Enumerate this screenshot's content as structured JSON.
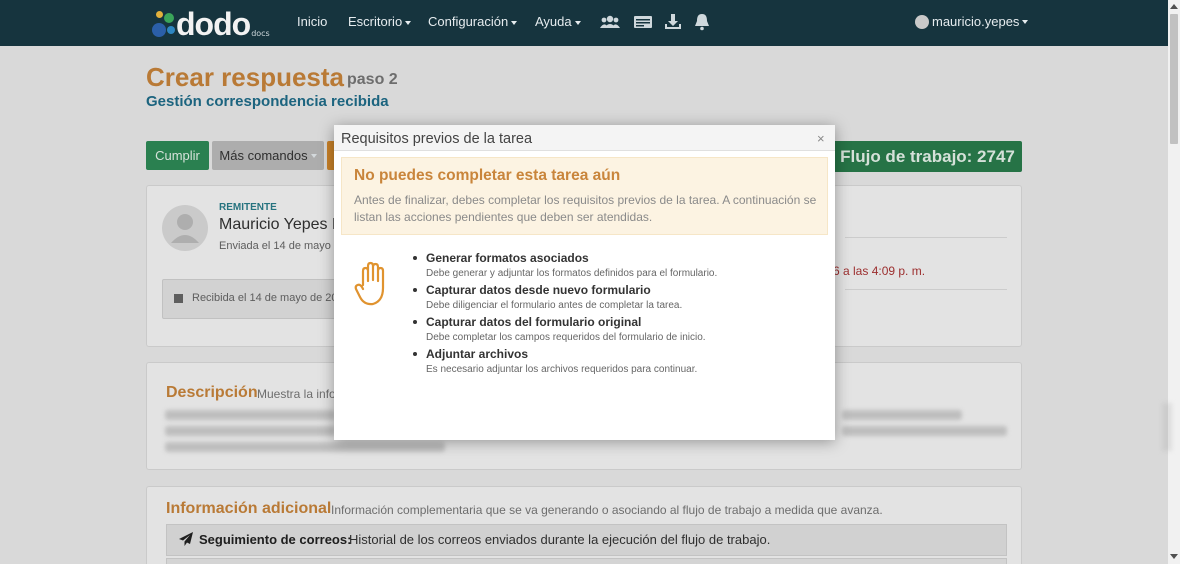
{
  "navbar": {
    "logo_text": "dodo",
    "logo_sub": "docs",
    "items": [
      {
        "label": "Inicio"
      },
      {
        "label": "Escritorio"
      },
      {
        "label": "Configuración"
      },
      {
        "label": "Ayuda"
      }
    ],
    "icons": [
      "users-icon",
      "card-icon",
      "download-icon",
      "bell-icon"
    ],
    "user": "mauricio.yepes"
  },
  "page": {
    "title": "Crear respuesta",
    "step": "paso 2",
    "subtitle": "Gestión correspondencia recibida"
  },
  "toolbar": {
    "cumplir": "Cumplir",
    "mas_comandos": "Más comandos",
    "workflow": "Flujo de trabajo: 2747"
  },
  "remitente": {
    "label": "REMITENTE",
    "name": "Mauricio Yepes F",
    "sent": "Enviada el 14 de mayo d",
    "received": "Recibida el 14 de mayo de 20",
    "right_date": "6 a las 4:09 p. m."
  },
  "descripcion": {
    "title": "Descripción",
    "subtitle": "Muestra la info"
  },
  "info": {
    "title": "Información adicional",
    "subtitle": "Información complementaria que se va generando o asociando al flujo de trabajo a medida que avanza.",
    "tracking_label": "Seguimiento de correos:",
    "tracking_text": "Historial de los correos enviados durante la ejecución del flujo de trabajo."
  },
  "modal": {
    "title": "Requisitos previos de la tarea",
    "close": "×",
    "alert_title": "No puedes completar esta tarea aún",
    "alert_text": "Antes de finalizar, debes completar los requisitos previos de la tarea. A continuación se listan las acciones pendientes que deben ser atendidas.",
    "requirements": [
      {
        "title": "Generar formatos asociados",
        "desc": "Debe generar y adjuntar los formatos definidos para el formulario."
      },
      {
        "title": "Capturar datos desde nuevo formulario",
        "desc": "Debe diligenciar el formulario antes de completar la tarea."
      },
      {
        "title": "Capturar datos del formulario original",
        "desc": "Debe completar los campos requeridos del formulario de inicio."
      },
      {
        "title": "Adjuntar archivos",
        "desc": "Es necesario adjuntar los archivos requeridos para continuar."
      }
    ]
  },
  "colors": {
    "navbar": "#16343e",
    "accent_orange": "#c9853b",
    "subtitle_blue": "#1f6d8a",
    "green": "#2e8b57",
    "alert_bg": "#fcf3e2"
  }
}
